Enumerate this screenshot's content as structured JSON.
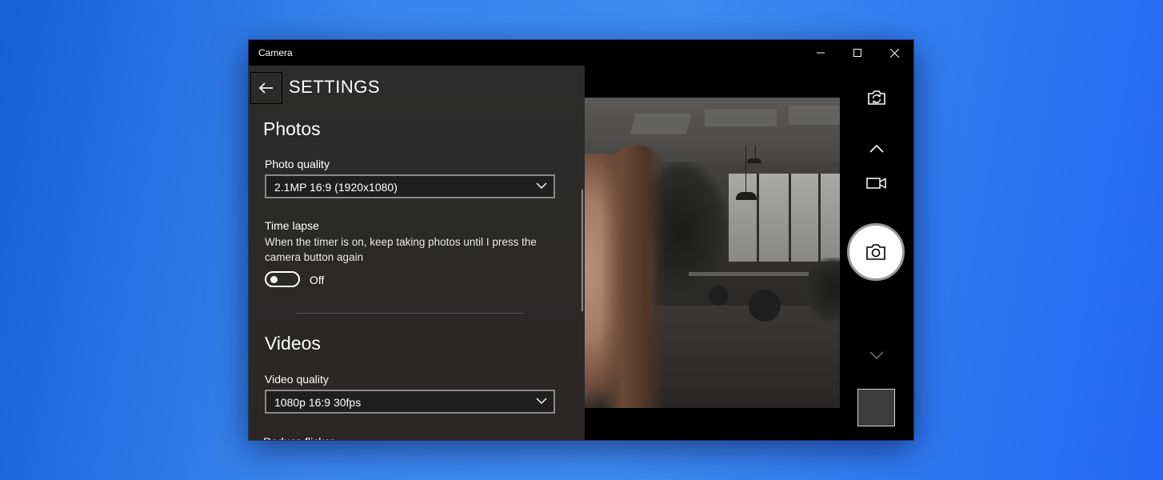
{
  "window": {
    "title": "Camera",
    "controls": {
      "minimize": "minimize",
      "maximize": "maximize",
      "close": "close"
    }
  },
  "settings": {
    "title": "SETTINGS",
    "photos": {
      "heading": "Photos",
      "photo_quality_label": "Photo quality",
      "photo_quality_value": "2.1MP 16:9 (1920x1080)",
      "time_lapse_label": "Time lapse",
      "time_lapse_desc": "When the timer is on, keep taking photos until I press the camera button again",
      "time_lapse_state": "Off"
    },
    "videos": {
      "heading": "Videos",
      "video_quality_label": "Video quality",
      "video_quality_value": "1080p 16:9 30fps",
      "next_item_partial": "Reduce flicker"
    }
  },
  "icons": {
    "back": "back-arrow-icon",
    "switch_camera": "switch-camera-icon",
    "chevron_up": "chevron-up-icon",
    "video_mode": "video-camera-icon",
    "photo_mode": "camera-icon",
    "chevron_down": "chevron-down-icon"
  },
  "colors": {
    "desktop": "#3a85ee",
    "panel": "#2b2b2b",
    "window": "#000000",
    "shutter": "#ffffff"
  }
}
